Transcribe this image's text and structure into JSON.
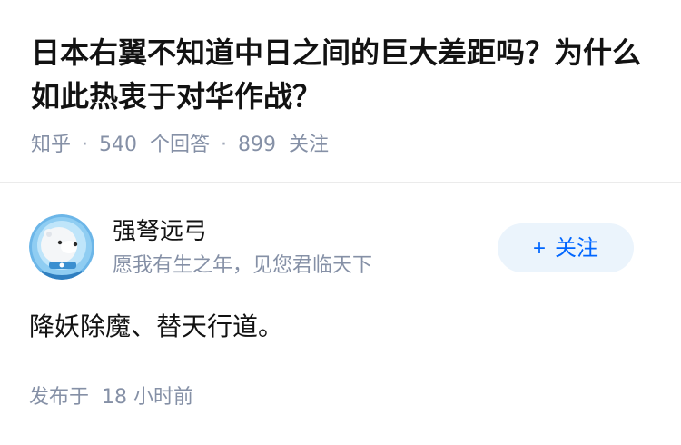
{
  "question": {
    "title": "日本右翼不知道中日之间的巨大差距吗？为什么如此热衷于对华作战？",
    "source": "知乎",
    "answers_count": "540",
    "answers_label": "个回答",
    "followers_count": "899",
    "followers_label": "关注",
    "separator": "·"
  },
  "answer": {
    "author": {
      "name": "强弩远弓",
      "bio": "愿我有生之年，见您君临天下",
      "avatar_icon": "astronaut-bear-avatar-icon"
    },
    "follow_button": {
      "icon": "+",
      "label": "关注"
    },
    "content": "降妖除魔、替天行道。",
    "publish": {
      "prefix": "发布于",
      "time": "18 小时前"
    }
  },
  "colors": {
    "text_primary": "#121212",
    "text_secondary": "#8590a6",
    "accent": "#0066ff",
    "follow_bg": "#ebf4fc",
    "divider": "#ebebeb"
  }
}
